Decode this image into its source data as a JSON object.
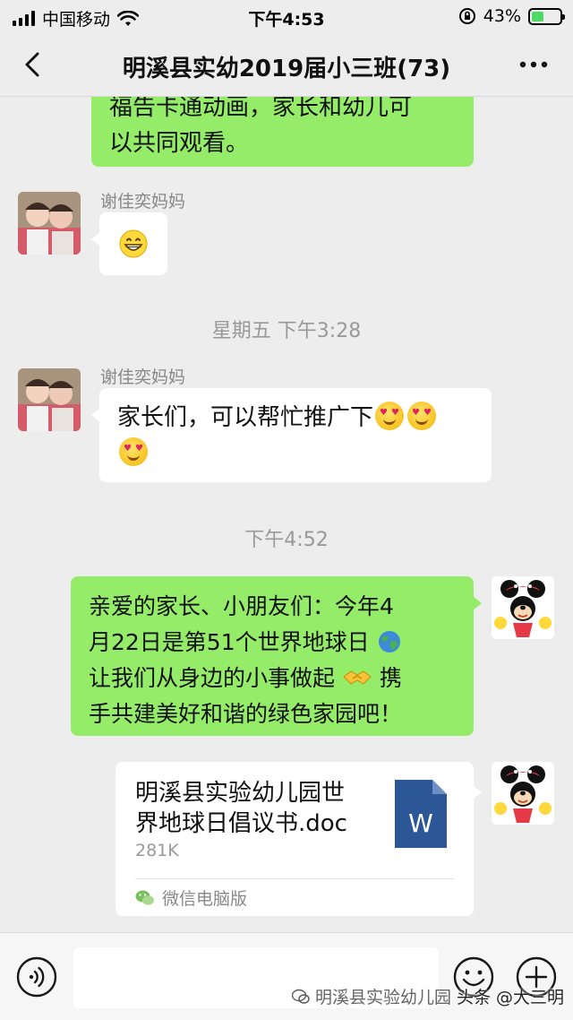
{
  "status_bar": {
    "carrier": "中国移动",
    "time": "下午4:53",
    "battery_percent": "43%",
    "battery_level": 0.43
  },
  "nav": {
    "title": "明溪县实幼2019届小三班(73)"
  },
  "messages": {
    "m1_text_line1": "福告卡通动画，家长和幼儿可",
    "m1_text_line2": "以共同观看。",
    "m2_sender": "谢佳奕妈妈",
    "m2_emoji": "grinning-face",
    "ts1": "星期五 下午3:28",
    "m3_sender": "谢佳奕妈妈",
    "m3_text": "家长们，可以帮忙推广下",
    "ts2": "下午4:52",
    "m4_line1": "亲爱的家长、小朋友们：今年4",
    "m4_line2": "月22日是第51个世界地球日",
    "m4_line3": "让我们从身边的小事做起",
    "m4_line3b": "携",
    "m4_line4": "手共建美好和谐的绿色家园吧！",
    "file_name_line1": "明溪县实验幼儿园世",
    "file_name_line2": "界地球日倡议书.doc",
    "file_size": "281K",
    "file_source": "微信电脑版",
    "file_icon_letter": "W"
  },
  "watermark": {
    "text": "头条 @大三明",
    "text_behind": "明溪县实验幼儿园"
  },
  "colors": {
    "green_bubble": "#95ec69",
    "background": "#ededed",
    "word_blue": "#2b5797"
  },
  "icons": {
    "back": "chevron-left-icon",
    "more": "more-dots-icon",
    "voice": "voice-icon",
    "emoji": "emoji-icon",
    "plus": "plus-icon"
  }
}
